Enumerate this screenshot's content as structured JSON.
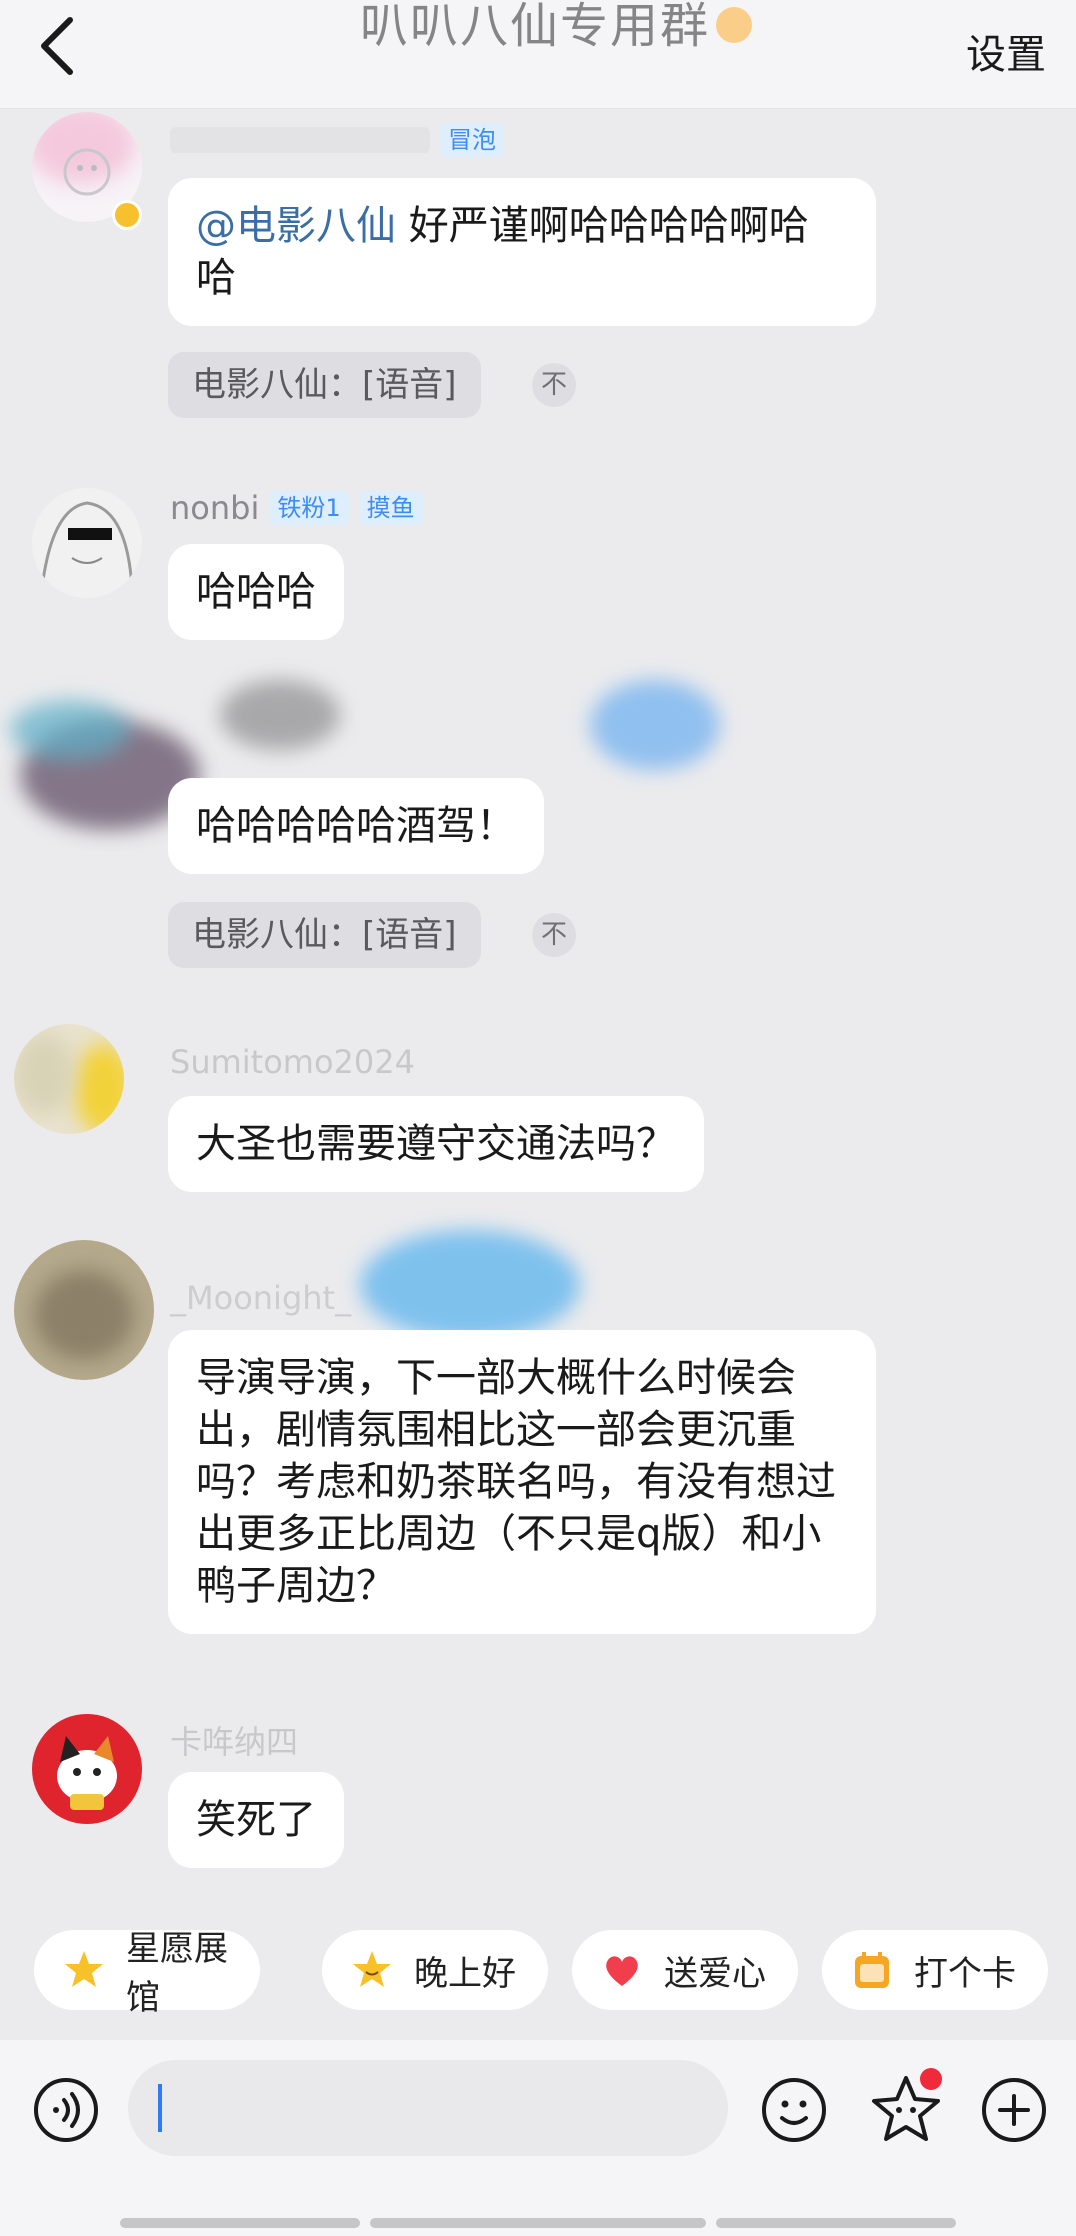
{
  "header": {
    "title": "叭叭八仙专用群",
    "settings_label": "设置"
  },
  "messages": [
    {
      "sender": "",
      "badges": [
        "冒泡"
      ],
      "text_mention": "@电影八仙",
      "text": " 好严谨啊哈哈哈哈啊哈哈",
      "quote": "电影八仙：[语音]"
    },
    {
      "sender": "nonbi",
      "badges": [
        "铁粉1",
        "摸鱼"
      ],
      "text": "哈哈哈"
    },
    {
      "sender": "",
      "badges": [],
      "text": "哈哈哈哈哈酒驾！",
      "quote": "电影八仙：[语音]"
    },
    {
      "sender": "Sumitomo2024",
      "badges": [],
      "text": "大圣也需要遵守交通法吗？"
    },
    {
      "sender": "_Moonight_",
      "badges": [],
      "text": "导演导演，下一部大概什么时候会出，剧情氛围相比这一部会更沉重吗？考虑和奶茶联名吗，有没有想过出更多正比周边（不只是q版）和小鸭子周边？"
    },
    {
      "sender": "卡哖纳四",
      "badges": [],
      "text": "笑死了"
    }
  ],
  "quote_top_symbol": "不",
  "quick_actions": [
    "星愿展馆",
    "晚上好",
    "送爱心",
    "打个卡"
  ],
  "colors": {
    "accent": "#3d8ef2",
    "notification": "#f0293b",
    "caret": "#2d7cf6"
  }
}
